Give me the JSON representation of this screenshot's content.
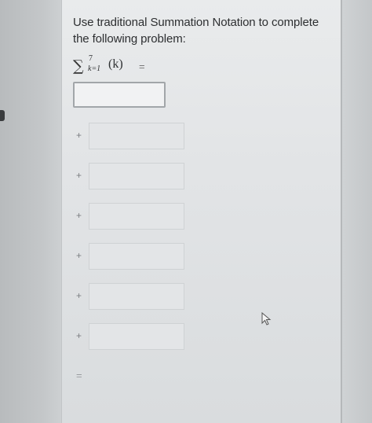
{
  "prompt": {
    "text": "Use traditional Summation Notation to complete the following problem:"
  },
  "expression": {
    "sigma": "∑",
    "upper": "7",
    "lower": "k=1",
    "term": "(k)",
    "equals": "="
  },
  "answer_box": {
    "value": ""
  },
  "term_rows": [
    {
      "operator": "+",
      "value": ""
    },
    {
      "operator": "+",
      "value": ""
    },
    {
      "operator": "+",
      "value": ""
    },
    {
      "operator": "+",
      "value": ""
    },
    {
      "operator": "+",
      "value": ""
    },
    {
      "operator": "+",
      "value": ""
    }
  ],
  "result_row": {
    "operator": "="
  },
  "icons": {
    "cursor": "mouse-pointer-icon"
  },
  "colors": {
    "panel": "#e6e8e9",
    "border": "#a2a6a9",
    "text": "#2d2f31"
  }
}
